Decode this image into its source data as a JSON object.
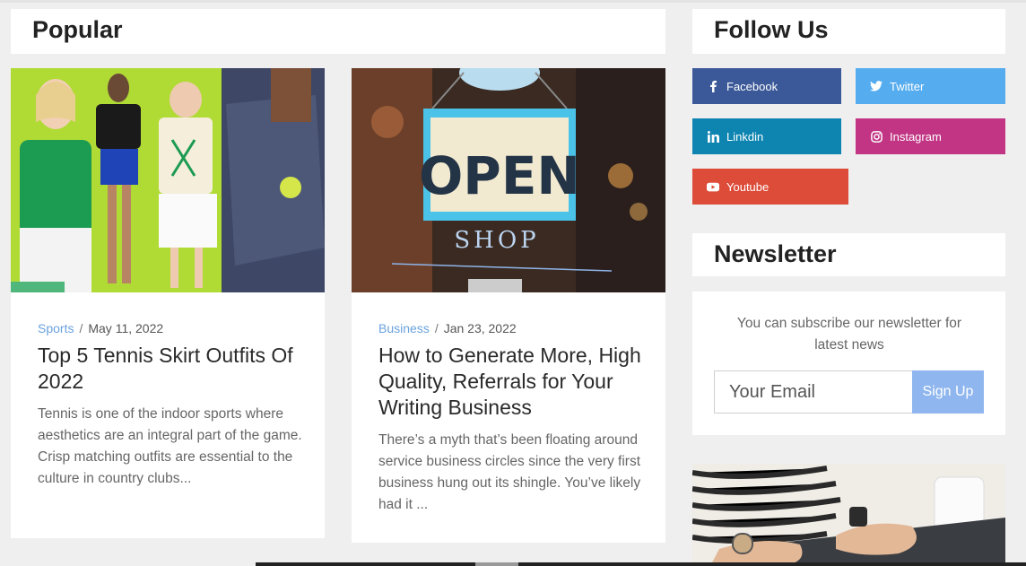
{
  "popular": {
    "heading": "Popular",
    "posts": [
      {
        "category": "Sports",
        "separator": "/",
        "date": "May 11, 2022",
        "title": "Top 5 Tennis Skirt Outfits Of 2022",
        "excerpt": "Tennis is one of the indoor sports where aesthetics are an integral part of the game. Crisp matching outfits are essential to the culture in country clubs..."
      },
      {
        "category": "Business",
        "separator": "/",
        "date": "Jan 23, 2022",
        "title": "How to Generate More, High Quality, Referrals for Your Writing Business",
        "excerpt": "There’s a myth that’s been floating around service business circles since the very first business hung out its shingle. You’ve likely had it ...",
        "image_sign_text": "OPEN",
        "image_sign_subtext": "SHOP"
      }
    ]
  },
  "follow": {
    "heading": "Follow Us",
    "buttons": [
      {
        "label": "Facebook",
        "icon": "facebook-icon",
        "color": "#3b5998"
      },
      {
        "label": "Twitter",
        "icon": "twitter-icon",
        "color": "#55acee"
      },
      {
        "label": "Linkdin",
        "icon": "linkedin-icon",
        "color": "#0e84b0"
      },
      {
        "label": "Instagram",
        "icon": "instagram-icon",
        "color": "#c13584"
      },
      {
        "label": "Youtube",
        "icon": "youtube-icon",
        "color": "#dd4b39"
      }
    ]
  },
  "newsletter": {
    "heading": "Newsletter",
    "description": "You can subscribe our newsletter for latest news",
    "email_placeholder": "Your Email",
    "signup_label": "Sign Up"
  }
}
